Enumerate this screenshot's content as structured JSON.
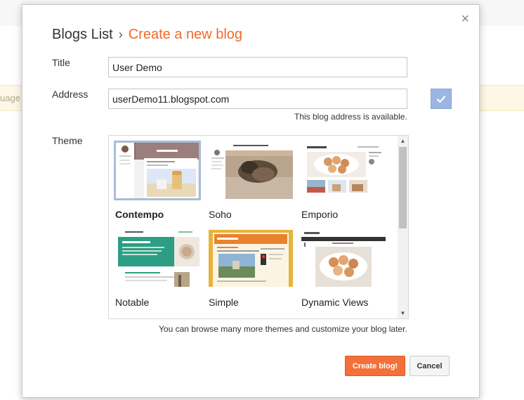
{
  "background": {
    "banner_text": "uage p"
  },
  "dialog": {
    "close_glyph": "×",
    "breadcrumb": {
      "parent": "Blogs List",
      "separator": "›",
      "current": "Create a new blog"
    },
    "title_field": {
      "label": "Title",
      "value": "User Demo"
    },
    "address_field": {
      "label": "Address",
      "value": "userDemo11.blogspot.com",
      "status": "This blog address is available."
    },
    "theme_field": {
      "label": "Theme",
      "selected": "Contempo",
      "themes": [
        {
          "name": "Contempo"
        },
        {
          "name": "Soho"
        },
        {
          "name": "Emporio"
        },
        {
          "name": "Notable"
        },
        {
          "name": "Simple"
        },
        {
          "name": "Dynamic Views"
        }
      ],
      "note": "You can browse many more themes and customize your blog later."
    },
    "buttons": {
      "create": "Create blog!",
      "cancel": "Cancel"
    }
  },
  "colors": {
    "accent_orange": "#f2692a",
    "check_button": "#9cb6e3",
    "selected_border": "#a8bcd8"
  }
}
